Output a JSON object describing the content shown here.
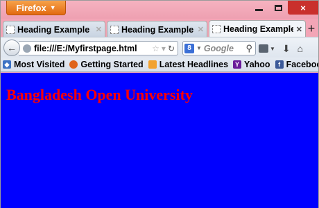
{
  "browser": {
    "menu_label": "Firefox",
    "window_controls": {
      "minimize": "minimize",
      "maximize": "maximize",
      "close": "×"
    }
  },
  "tabs": [
    {
      "label": "Heading Example",
      "active": false
    },
    {
      "label": "Heading Example",
      "active": false
    },
    {
      "label": "Heading Example",
      "active": true
    }
  ],
  "newtab_label": "+",
  "nav": {
    "url": "file:///E:/Myfirstpage.html",
    "search_placeholder": "Google",
    "search_engine_icon": "8"
  },
  "bookmarks": [
    {
      "label": "Most Visited",
      "icon": "most-visited-icon"
    },
    {
      "label": "Getting Started",
      "icon": "firefox-icon"
    },
    {
      "label": "Latest Headlines",
      "icon": "rss-icon"
    },
    {
      "label": "Yahoo",
      "icon": "yahoo-icon"
    },
    {
      "label": "Facebook",
      "icon": "facebook-icon"
    }
  ],
  "page": {
    "heading": "Bangladesh Open University",
    "background": "#0000ff",
    "heading_color": "#ff0000"
  },
  "colors": {
    "titlebar": "#f3a5b6",
    "firefox_button": "#e36a11",
    "close_button": "#c9302c"
  }
}
